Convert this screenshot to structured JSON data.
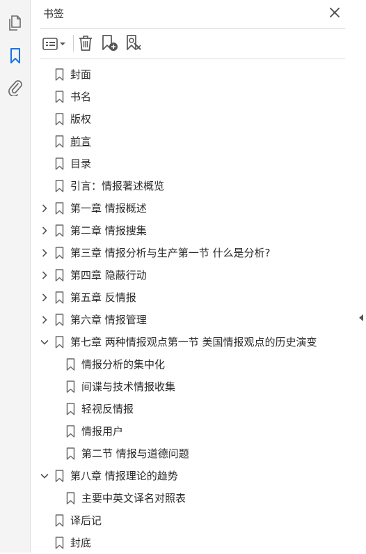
{
  "rail": {
    "items": [
      {
        "name": "pages-panel-icon"
      },
      {
        "name": "bookmarks-panel-icon"
      },
      {
        "name": "attachments-panel-icon"
      }
    ],
    "active_color": "#1473e6"
  },
  "panel": {
    "title": "书签",
    "toolbar": {
      "options": "options-menu-icon",
      "delete": "trash-icon",
      "new_bookmark": "add-bookmark-icon",
      "bookmark_from_selection": "bookmark-search-icon"
    }
  },
  "bookmarks": [
    {
      "label": "封面",
      "level": 0,
      "expander": "none"
    },
    {
      "label": "书名",
      "level": 0,
      "expander": "none"
    },
    {
      "label": "版权",
      "level": 0,
      "expander": "none"
    },
    {
      "label": "前言",
      "level": 0,
      "expander": "none",
      "underlined": true
    },
    {
      "label": "目录",
      "level": 0,
      "expander": "none"
    },
    {
      "label": "引言：情报著述概览",
      "level": 0,
      "expander": "none"
    },
    {
      "label": "第一章  情报概述",
      "level": 0,
      "expander": "collapsed"
    },
    {
      "label": "第二章  情报搜集",
      "level": 0,
      "expander": "collapsed"
    },
    {
      "label": "第三章  情报分析与生产第一节  什么是分析?",
      "level": 0,
      "expander": "collapsed"
    },
    {
      "label": "第四章  隐蔽行动",
      "level": 0,
      "expander": "collapsed"
    },
    {
      "label": "第五章  反情报",
      "level": 0,
      "expander": "collapsed"
    },
    {
      "label": "第六章  情报管理",
      "level": 0,
      "expander": "collapsed"
    },
    {
      "label": "第七章  两种情报观点第一节  美国情报观点的历史演变",
      "level": 0,
      "expander": "expanded"
    },
    {
      "label": "情报分析的集中化",
      "level": 1,
      "expander": "none"
    },
    {
      "label": "间谍与技术情报收集",
      "level": 1,
      "expander": "none"
    },
    {
      "label": "轻视反情报",
      "level": 1,
      "expander": "none"
    },
    {
      "label": "情报用户",
      "level": 1,
      "expander": "none"
    },
    {
      "label": "第二节  情报与道德问题",
      "level": 1,
      "expander": "none"
    },
    {
      "label": "第八章  情报理论的趋势",
      "level": 0,
      "expander": "expanded"
    },
    {
      "label": "主要中英文译名对照表",
      "level": 1,
      "expander": "none"
    },
    {
      "label": "译后记",
      "level": 0,
      "expander": "none"
    },
    {
      "label": "封底",
      "level": 0,
      "expander": "none"
    }
  ]
}
